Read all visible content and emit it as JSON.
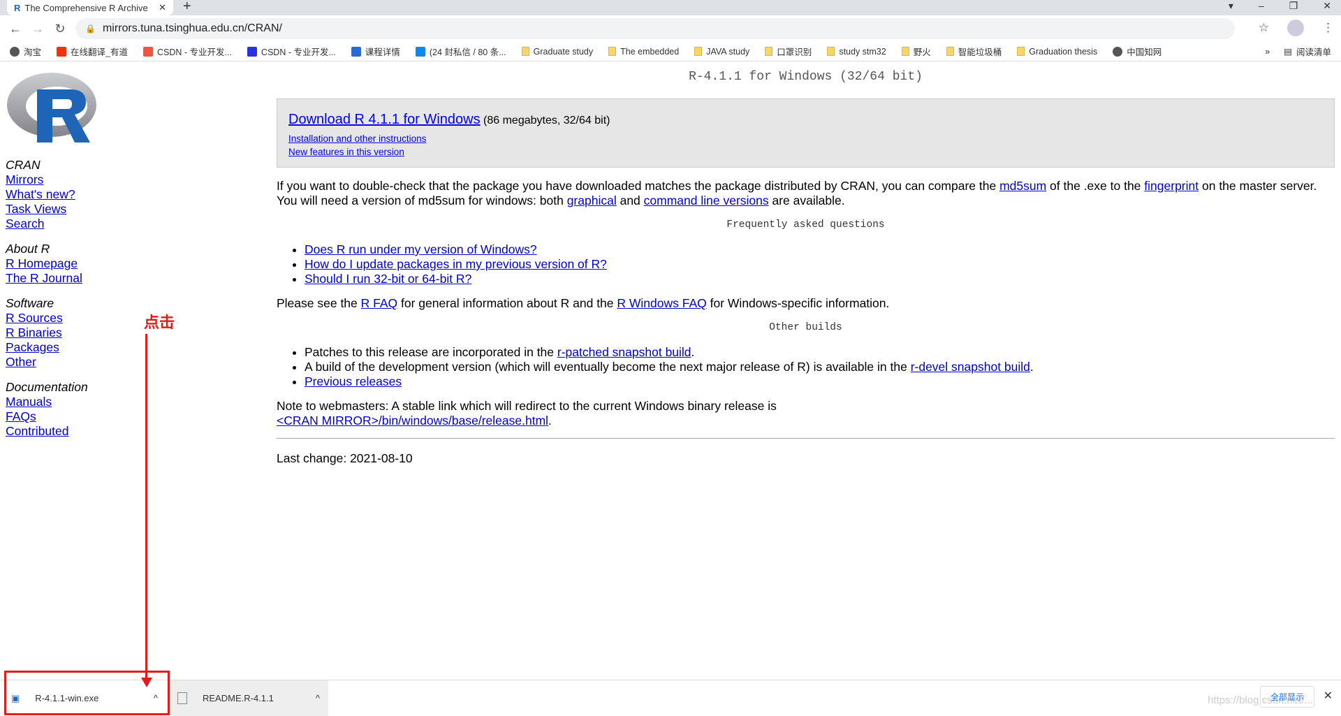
{
  "browser": {
    "tab_title": "The Comprehensive R Archive",
    "url": "mirrors.tuna.tsinghua.edu.cn/CRAN/",
    "bookmarks": [
      {
        "label": "淘宝",
        "icon": "globe-icon"
      },
      {
        "label": "在线翻译_有道",
        "icon": "youdao-icon"
      },
      {
        "label": "CSDN - 专业开发...",
        "icon": "csdn-icon"
      },
      {
        "label": "CSDN - 专业开发...",
        "icon": "baidu-icon"
      },
      {
        "label": "课程详情",
        "icon": "course-icon"
      },
      {
        "label": "(24 封私信 / 80 条...",
        "icon": "zhihu-icon"
      },
      {
        "label": "Graduate study",
        "icon": "folder-icon"
      },
      {
        "label": "The embedded",
        "icon": "folder-icon"
      },
      {
        "label": "JAVA study",
        "icon": "folder-icon"
      },
      {
        "label": "口罩识别",
        "icon": "folder-icon"
      },
      {
        "label": "study stm32",
        "icon": "folder-icon"
      },
      {
        "label": "野火",
        "icon": "folder-icon"
      },
      {
        "label": "智能垃圾桶",
        "icon": "folder-icon"
      },
      {
        "label": "Graduation thesis",
        "icon": "folder-icon"
      },
      {
        "label": "中国知网",
        "icon": "globe-icon"
      }
    ],
    "more": "»",
    "reading_list": "阅读清单"
  },
  "sidebar": {
    "sections": [
      {
        "heading": "CRAN",
        "links": [
          "Mirrors",
          "What's new?",
          "Task Views",
          "Search"
        ]
      },
      {
        "heading": "About R",
        "links": [
          "R Homepage",
          "The R Journal"
        ]
      },
      {
        "heading": "Software",
        "links": [
          "R Sources",
          "R Binaries",
          "Packages",
          "Other"
        ]
      },
      {
        "heading": "Documentation",
        "links": [
          "Manuals",
          "FAQs",
          "Contributed"
        ]
      }
    ]
  },
  "page": {
    "title": "R-4.1.1 for Windows (32/64 bit)",
    "download_link": "Download R 4.1.1 for Windows",
    "download_desc": "(86 megabytes, 32/64 bit)",
    "install_link": "Installation and other instructions",
    "features_link": "New features in this version",
    "p1_a": "If you want to double-check that the package you have downloaded matches the package distributed by CRAN, you can compare the ",
    "md5sum": "md5sum",
    "p1_b": " of the .exe to the ",
    "fingerprint": "fingerprint",
    "p1_c": " on the master server. You will need a version of md5sum for windows: both ",
    "graphical": "graphical",
    "p1_d": " and ",
    "cmdline": "command line versions",
    "p1_e": " are available.",
    "faq_heading": "Frequently asked questions",
    "faq": [
      "Does R run under my version of Windows?",
      "How do I update packages in my previous version of R?",
      "Should I run 32-bit or 64-bit R?"
    ],
    "p2_a": "Please see the ",
    "rfaq": "R FAQ",
    "p2_b": " for general information about R and the ",
    "rwinfaq": "R Windows FAQ",
    "p2_c": " for Windows-specific information.",
    "other_heading": "Other builds",
    "ob1_a": "Patches to this release are incorporated in the ",
    "ob1_link": "r-patched snapshot build",
    "ob1_b": ".",
    "ob2_a": "A build of the development version (which will eventually become the next major release of R) is available in the ",
    "ob2_link": "r-devel snapshot build",
    "ob2_b": ".",
    "ob3_link": "Previous releases",
    "note": "Note to webmasters: A stable link which will redirect to the current Windows binary release is",
    "note_link": "<CRAN MIRROR>/bin/windows/base/release.html",
    "note_end": ".",
    "last_change": "Last change: 2021-08-10"
  },
  "downloads": {
    "items": [
      "R-4.1.1-win.exe",
      "README.R-4.1.1"
    ],
    "show_all": "全部显示",
    "watermark": "https://blog.csdn.net/..."
  },
  "annotation": {
    "text": "点击",
    "color": "#e21b1b"
  }
}
